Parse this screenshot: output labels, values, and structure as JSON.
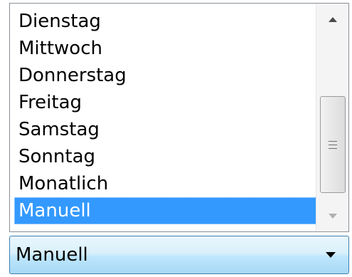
{
  "listbox": {
    "items": [
      {
        "label": "Dienstag",
        "selected": false
      },
      {
        "label": "Mittwoch",
        "selected": false
      },
      {
        "label": "Donnerstag",
        "selected": false
      },
      {
        "label": "Freitag",
        "selected": false
      },
      {
        "label": "Samstag",
        "selected": false
      },
      {
        "label": "Sonntag",
        "selected": false
      },
      {
        "label": "Monatlich",
        "selected": false
      },
      {
        "label": "Manuell",
        "selected": true
      }
    ],
    "selection_color": "#3399ff"
  },
  "scrollbar": {
    "up_icon": "chevron-up-icon",
    "down_icon": "chevron-down-icon",
    "thumb_icon": "grip-icon"
  },
  "combo": {
    "value": "Manuell",
    "dropdown_icon": "chevron-down-icon"
  }
}
